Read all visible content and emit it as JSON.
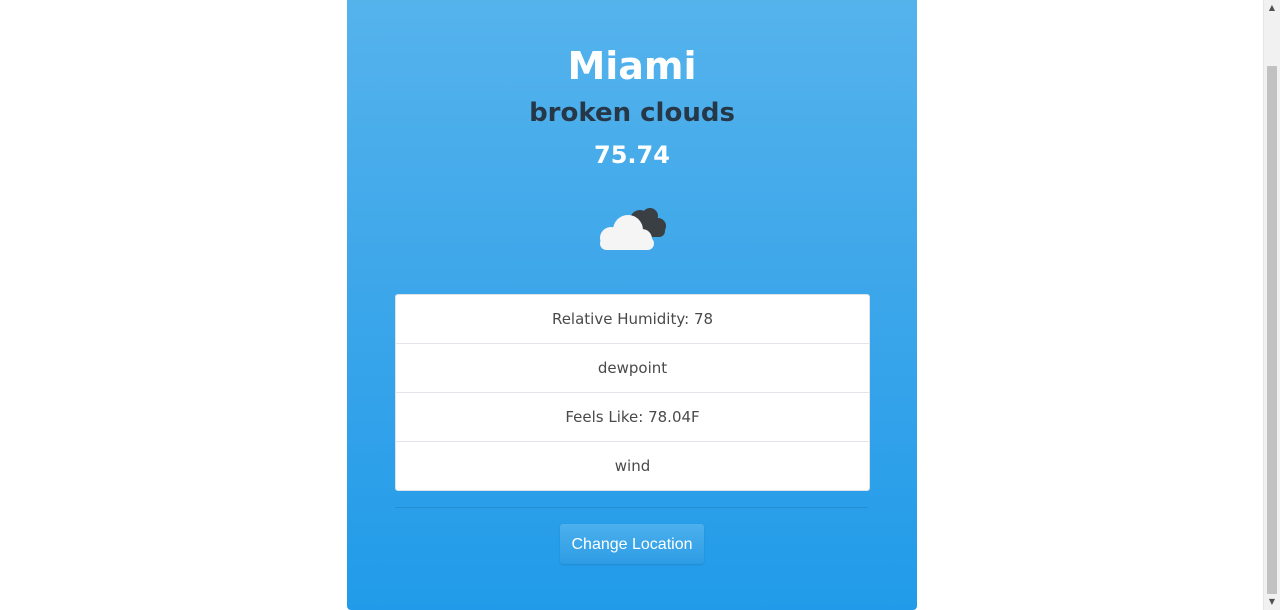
{
  "weather": {
    "city": "Miami",
    "condition": "broken clouds",
    "temperature": "75.74",
    "icon": "broken-clouds-icon"
  },
  "details": [
    {
      "label": "Relative Humidity: 78"
    },
    {
      "label": "dewpoint"
    },
    {
      "label": "Feels Like: 78.04F"
    },
    {
      "label": "wind"
    }
  ],
  "actions": {
    "change_location_label": "Change Location"
  },
  "colors": {
    "card_top": "#55b3ec",
    "card_bottom": "#219be9",
    "condition_text": "#263847",
    "button": "#2d9ce5"
  },
  "scrollbar": {
    "up_arrow": "▲",
    "down_arrow": "▼"
  }
}
